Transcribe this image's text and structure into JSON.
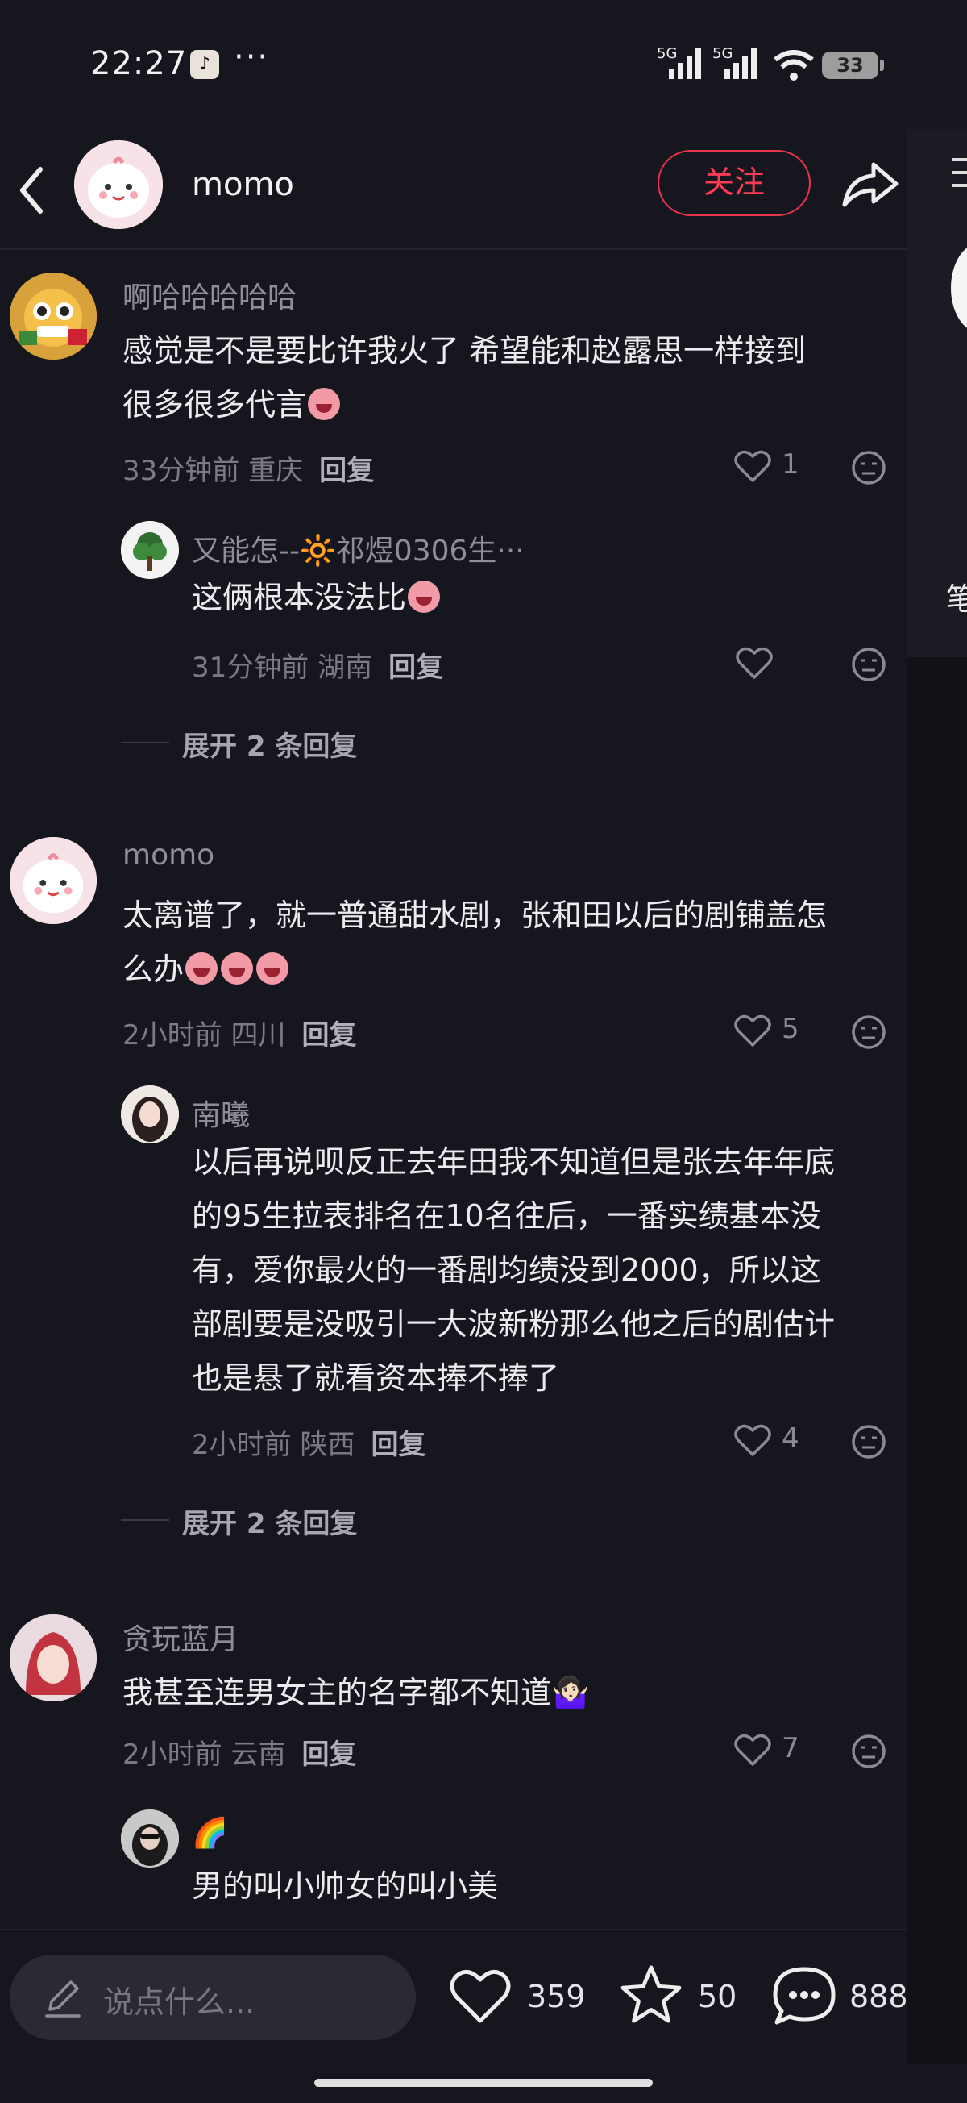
{
  "status": {
    "time": "22:27",
    "more": "···",
    "net1": "5G",
    "net2": "5G",
    "battery": "33"
  },
  "header": {
    "name": "momo",
    "follow": "关注"
  },
  "peek": {
    "char": "笔"
  },
  "comments": [
    {
      "user": "啊哈哈哈哈哈",
      "text_line1": "感觉是不是要比许我火了 希望能和赵露思一样接到",
      "text_line2": "很多很多代言",
      "time": "33分钟前 重庆",
      "reply": "回复",
      "likes": "1",
      "replies": [
        {
          "user": "又能怎--🔆祁煜0306生···",
          "text": "这俩根本没法比",
          "time": "31分钟前 湖南",
          "reply": "回复",
          "likes": ""
        }
      ],
      "expand": "展开 2 条回复"
    },
    {
      "user": "momo",
      "text_line1": "太离谱了，就一普通甜水剧，张和田以后的剧铺盖怎",
      "text_line2": "么办",
      "time": "2小时前 四川",
      "reply": "回复",
      "likes": "5",
      "replies": [
        {
          "user": "南曦",
          "lines": [
            "以后再说呗反正去年田我不知道但是张去年年底",
            "的95生拉表排名在10名往后，一番实绩基本没",
            "有，爱你最火的一番剧均绩没到2000，所以这",
            "部剧要是没吸引一大波新粉那么他之后的剧估计",
            "也是悬了就看资本捧不捧了"
          ],
          "time": "2小时前 陕西",
          "reply": "回复",
          "likes": "4"
        }
      ],
      "expand": "展开 2 条回复"
    },
    {
      "user": "贪玩蓝月",
      "text_line1": "我甚至连男女主的名字都不知道🤷🏻‍♀️",
      "time": "2小时前 云南",
      "reply": "回复",
      "likes": "7",
      "replies": [
        {
          "user": "🌈",
          "text": "男的叫小帅女的叫小美"
        }
      ]
    }
  ],
  "bottom": {
    "placeholder": "说点什么...",
    "likes": "359",
    "stars": "50",
    "comments": "888"
  },
  "colors": {
    "accent": "#ff3b55",
    "bg": "#16161e"
  }
}
